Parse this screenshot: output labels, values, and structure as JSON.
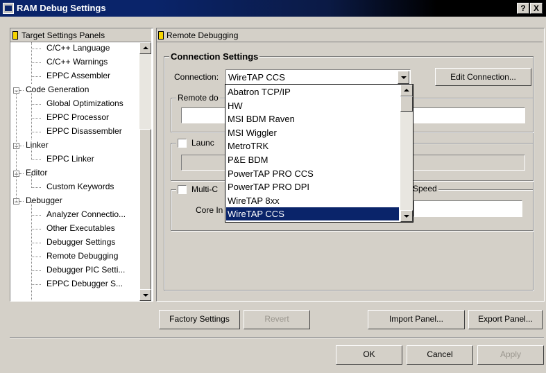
{
  "window": {
    "title": "RAM Debug Settings",
    "help_label": "?",
    "close_label": "X"
  },
  "tree": {
    "header": "Target Settings Panels",
    "items": [
      {
        "label": "C/C++ Language"
      },
      {
        "label": "C/C++ Warnings"
      },
      {
        "label": "EPPC Assembler"
      },
      {
        "label": "Code Generation",
        "expander": "−"
      },
      {
        "label": "Global Optimizations"
      },
      {
        "label": "EPPC Processor"
      },
      {
        "label": "EPPC Disassembler"
      },
      {
        "label": "Linker",
        "expander": "−"
      },
      {
        "label": "EPPC Linker"
      },
      {
        "label": "Editor",
        "expander": "−"
      },
      {
        "label": "Custom Keywords"
      },
      {
        "label": "Debugger",
        "expander": "−"
      },
      {
        "label": "Analyzer Connectio..."
      },
      {
        "label": "Other Executables"
      },
      {
        "label": "Debugger Settings"
      },
      {
        "label": "Remote Debugging"
      },
      {
        "label": "Debugger PIC Setti..."
      },
      {
        "label": "EPPC Debugger S..."
      }
    ]
  },
  "panel": {
    "header": "Remote Debugging",
    "connection_group": "Connection Settings",
    "connection_label": "Connection:",
    "connection_value": "WireTAP CCS",
    "edit_connection": "Edit Connection...",
    "remote_download_label": "Remote do",
    "launch_label": "Launc",
    "multicore_label": "Multi-C",
    "speed_label": "Speed",
    "core_label": "Core In"
  },
  "dropdown": {
    "options": [
      "Abatron TCP/IP",
      "HW",
      "MSI BDM Raven",
      "MSI Wiggler",
      "MetroTRK",
      "P&E BDM",
      "PowerTAP PRO CCS",
      "PowerTAP PRO DPI",
      "WireTAP 8xx",
      "WireTAP CCS"
    ],
    "selected": "WireTAP CCS"
  },
  "buttons": {
    "factory": "Factory Settings",
    "revert": "Revert",
    "import": "Import Panel...",
    "export": "Export Panel...",
    "ok": "OK",
    "cancel": "Cancel",
    "apply": "Apply"
  }
}
